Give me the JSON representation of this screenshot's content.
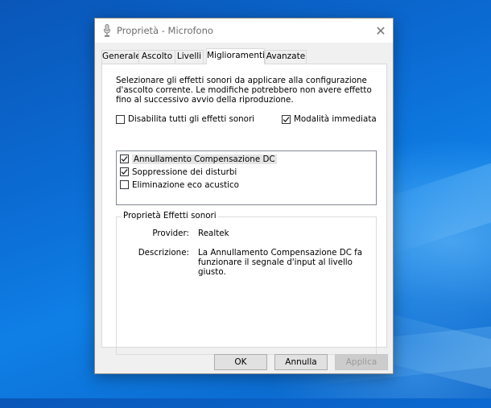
{
  "window": {
    "title": "Proprietà - Microfono",
    "close_symbol": "✕"
  },
  "tabs": [
    {
      "label": "Generale"
    },
    {
      "label": "Ascolto"
    },
    {
      "label": "Livelli"
    },
    {
      "label": "Miglioramenti",
      "active": true
    },
    {
      "label": "Avanzate"
    }
  ],
  "enhancements": {
    "description": "Selezionare gli effetti sonori da applicare alla configurazione d'ascolto corrente. Le modifiche potrebbero non avere effetto fino al successivo avvio della riproduzione.",
    "disable_all": {
      "label": "Disabilita tutti gli effetti sonori",
      "checked": false
    },
    "immediate_mode": {
      "label": "Modalità immediata",
      "checked": true
    },
    "effects": [
      {
        "label": "Annullamento Compensazione DC",
        "checked": true,
        "selected": true
      },
      {
        "label": "Soppressione dei disturbi",
        "checked": true,
        "selected": false
      },
      {
        "label": "Eliminazione eco acustico",
        "checked": false,
        "selected": false
      }
    ]
  },
  "properties": {
    "group_label": "Proprietà Effetti sonori",
    "provider_label": "Provider:",
    "provider_value": "Realtek",
    "description_label": "Descrizione:",
    "description_value": "La Annullamento Compensazione DC fa funzionare il segnale d'input al livello giusto."
  },
  "buttons": {
    "ok": "OK",
    "cancel": "Annulla",
    "apply": "Applica"
  },
  "icons": {
    "app": "microphone-icon",
    "close": "close-icon",
    "check": "checkmark-icon"
  }
}
